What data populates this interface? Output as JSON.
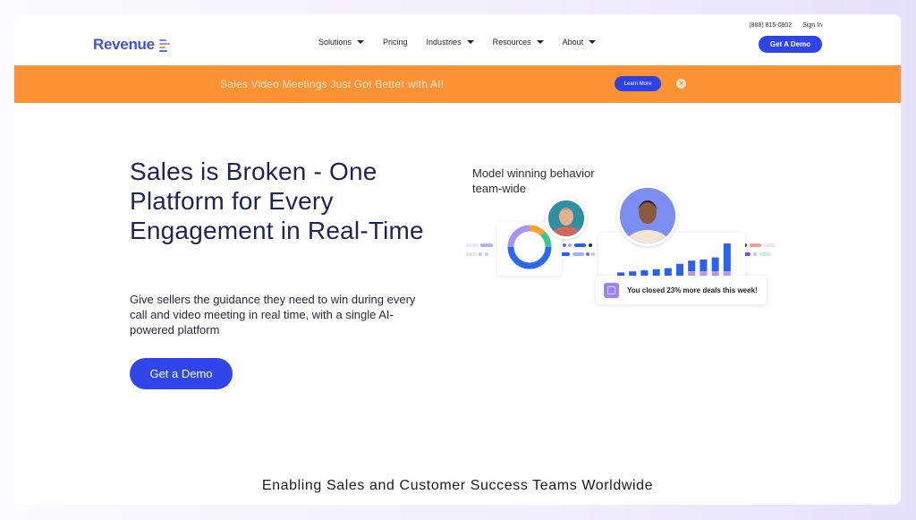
{
  "brand": {
    "name": "Revenue",
    "accent": "#3046ea",
    "banner_color": "#fd9234",
    "title_color": "#1e2459"
  },
  "header": {
    "logo_text": "Revenue",
    "nav": [
      {
        "label": "Solutions",
        "has_dropdown": true
      },
      {
        "label": "Pricing",
        "has_dropdown": false
      },
      {
        "label": "Industries",
        "has_dropdown": true
      },
      {
        "label": "Resources",
        "has_dropdown": true
      },
      {
        "label": "About",
        "has_dropdown": true
      }
    ],
    "phone": "(888) 815-0802",
    "sign_in": "Sign In",
    "cta": "Get A Demo"
  },
  "banner": {
    "text": "Sales Video Meetings Just Got Better with AI!",
    "button": "Learn More",
    "close_icon": "close-circle-icon"
  },
  "hero": {
    "title": "Sales is Broken - One Platform for Every Engagement in Real-Time",
    "subtitle": "Give sellers the guidance they need to win during every call and video meeting in real time, with a single AI-powered platform",
    "cta": "Get a Demo"
  },
  "illustration": {
    "caption": "Model winning behavior team-wide",
    "donut_segments": [
      {
        "label": "blue",
        "value": 50,
        "color": "#2a6af0"
      },
      {
        "label": "lavender",
        "value": 25,
        "color": "#a895f2"
      },
      {
        "label": "orange",
        "value": 12.5,
        "color": "#f6a22e"
      },
      {
        "label": "green",
        "value": 12.5,
        "color": "#3dc48a"
      }
    ],
    "bars": [
      {
        "total": 3,
        "base": 0
      },
      {
        "total": 4,
        "base": 0
      },
      {
        "total": 5,
        "base": 0
      },
      {
        "total": 6,
        "base": 0
      },
      {
        "total": 7,
        "base": 0
      },
      {
        "total": 11,
        "base": 0
      },
      {
        "total": 14,
        "base": 4
      },
      {
        "total": 15,
        "base": 4
      },
      {
        "total": 17,
        "base": 4
      },
      {
        "total": 30,
        "base": 4
      }
    ],
    "toast": "You closed 23% more deals this week!"
  },
  "footer_tagline": "Enabling Sales and Customer Success Teams Worldwide"
}
